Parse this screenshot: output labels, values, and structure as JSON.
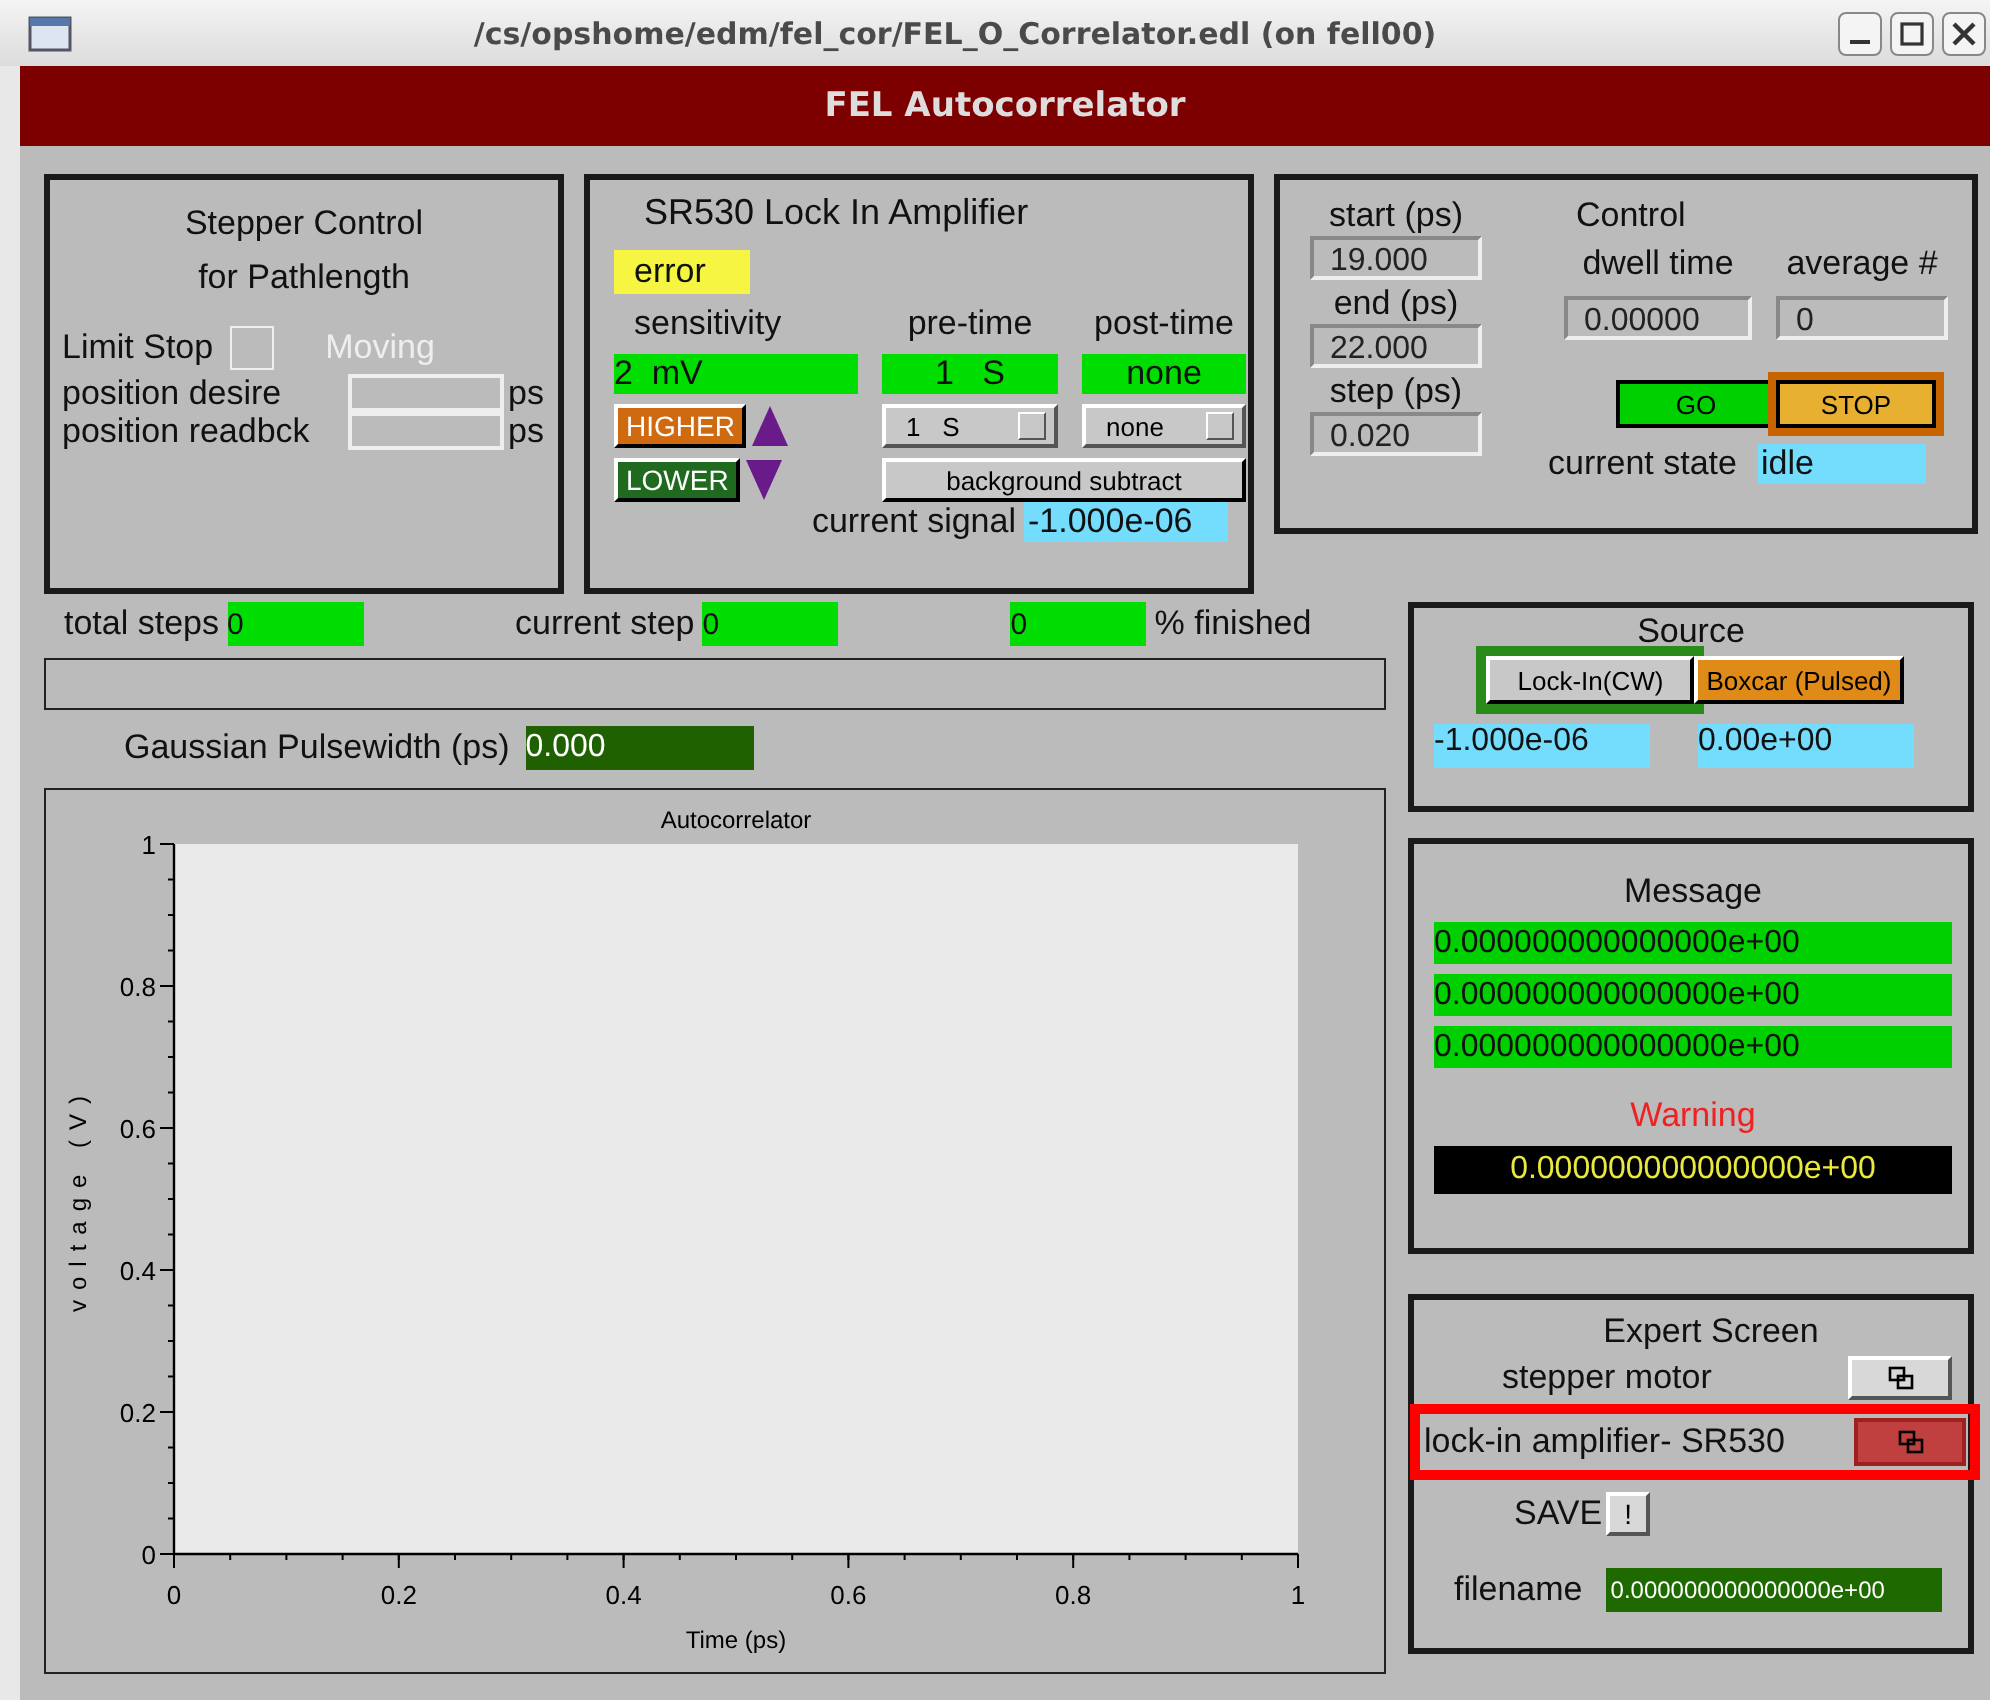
{
  "window": {
    "title": "/cs/opshome/edm/fel_cor/FEL_O_Correlator.edl (on fell00)"
  },
  "header": {
    "title": "FEL Autocorrelator"
  },
  "stepper": {
    "title_lines": [
      "Stepper Control",
      "for Pathlength"
    ],
    "limit_stop": {
      "label": "Limit Stop",
      "checked": false
    },
    "moving": {
      "label": "Moving",
      "active": false
    },
    "fields": [
      {
        "label": "position desire",
        "unit": "ps"
      },
      {
        "label": "position readbck",
        "unit": "ps"
      }
    ]
  },
  "lockin": {
    "title": "SR530 Lock In Amplifier",
    "status": "error",
    "columns": [
      {
        "label": "sensitivity",
        "value": "2  mV"
      },
      {
        "label": "pre-time",
        "value": "1   S"
      },
      {
        "label": "post-time",
        "value": "none"
      }
    ],
    "higher": "HIGHER",
    "lower": "LOWER",
    "menus": [
      {
        "value": "1   S"
      },
      {
        "value": "none"
      }
    ],
    "background_button": "background subtract",
    "signal": {
      "label": "current signal",
      "value": "-1.000e-06"
    }
  },
  "control": {
    "title": "Control",
    "fields": [
      {
        "label": "start (ps)",
        "value": "19.000"
      },
      {
        "label": "end (ps)",
        "value": "22.000"
      },
      {
        "label": "step (ps)",
        "value": "0.020"
      }
    ],
    "dwell": {
      "label": "dwell time",
      "value": "0.00000"
    },
    "average": {
      "label": "average #",
      "value": "0"
    },
    "buttons": [
      {
        "label": "GO",
        "kind": "go",
        "selected": false
      },
      {
        "label": "STOP",
        "kind": "stop",
        "selected": true
      }
    ],
    "state": {
      "label": "current state",
      "value": "idle"
    }
  },
  "progress": {
    "total_steps": {
      "label": "total steps",
      "value": "0"
    },
    "current_step": {
      "label": "current step",
      "value": "0"
    },
    "finished": {
      "value": "0",
      "label": "% finished"
    }
  },
  "pulsewidth": {
    "label": "Gaussian Pulsewidth (ps)",
    "value": "0.000"
  },
  "plot": {
    "chart_data": {
      "type": "line",
      "title": "Autocorrelator",
      "xlabel": "Time (ps)",
      "ylabel": "voltage (V)",
      "xlim": [
        0,
        1
      ],
      "ylim": [
        0,
        1
      ],
      "xticks": [
        0,
        0.2,
        0.4,
        0.6,
        0.8,
        1
      ],
      "yticks": [
        0,
        0.2,
        0.4,
        0.6,
        0.8,
        1
      ]
    }
  },
  "source": {
    "title": "Source",
    "buttons": [
      {
        "label": "Lock-In(CW)",
        "kind": "lockin",
        "selected": true
      },
      {
        "label": "Boxcar (Pulsed)",
        "kind": "boxcar",
        "selected": false
      }
    ],
    "readings": [
      "-1.000e-06",
      "0.00e+00"
    ]
  },
  "message": {
    "title": "Message",
    "lines": [
      "0.000000000000000e+00",
      "0.000000000000000e+00",
      "0.000000000000000e+00"
    ],
    "warning_title": "Warning",
    "warning": "0.000000000000000e+00"
  },
  "expert": {
    "title": "Expert Screen",
    "items": [
      {
        "label": "stepper motor",
        "highlighted": false
      },
      {
        "label": "lock-in amplifier- SR530",
        "highlighted": true
      }
    ],
    "save": {
      "label": "SAVE",
      "button": "!"
    },
    "filename": {
      "label": "filename",
      "value": "0.000000000000000e+00"
    }
  }
}
